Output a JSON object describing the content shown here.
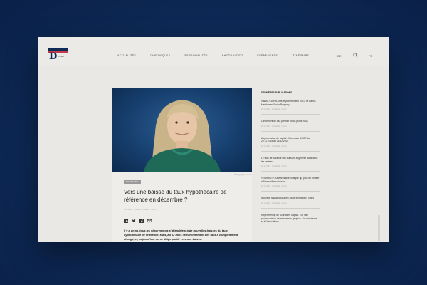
{
  "header": {
    "logo_text": "D",
    "logo_sub": "impact",
    "nav": [
      "ACTUALITÉS",
      "CHRONIQUES",
      "PERSONALITÉS",
      "PHOTO-VIDEO",
      "ÉVÉNEMENTS",
      "ITINÉRAIRE"
    ],
    "right_label": "DE",
    "lang": "FR"
  },
  "article": {
    "photo_credit": "© Copyright Limited",
    "tag": "ECONOMIE",
    "title": "Vers une baisse du taux hypothécaire de référence en décembre ?",
    "meta": "Le Temps  ·  Octobre  ·  Articles  ·  2023",
    "lead": "Il y a un an, tous les observateurs s’attendaient à de nouvelles baisses du taux hypothécaire de référence. Mais, au 12 mois l’environnement des taux a complètement changé, et, aujourd’hui, on se dirige plutôt vers une baisse."
  },
  "sidebar": {
    "heading": "DERNIÈRES PUBLICATIONS",
    "items": [
      {
        "title": "Valais : Coffres-forts et patrimonieux (ISG) de Banks Merkhoried Swiss Property",
        "meta": "26.11.2023  ·  Actualités  ·  Ouvrir"
      },
      {
        "title": "Lancement du tout premier fonds profité tous",
        "meta": "26.11.2023  ·  Actualités  ·  Ouvrir"
      },
      {
        "title": "Augmentation de capital : Commune BCGE du 20.11.2024 au 06.12.2024",
        "meta": "26.11.2023  ·  Actualités  ·  Ouvrir"
      },
      {
        "title": "Le taux de vacance des bureaux augmenté dans deux les centres",
        "meta": "26.11.2023  ·  Actualités  ·  Ouvrir"
      },
      {
        "title": "«Tourne 2.0 : Une tentative politique qui pourrait profiter à l’immobilier suisse?»",
        "meta": "26.11.2023  ·  Actualités  ·  Ouvrir"
      },
      {
        "title": "Nouvelle hausses pour les fonds immobiliers cotés",
        "meta": "26.11.2023  ·  Actualités  ·  Ouvrir"
      }
    ],
    "extra": "Roger Hennig de Schroders Capital: «Je vise promouvoir un investissement propice à la croissance et à l’innovation»"
  }
}
